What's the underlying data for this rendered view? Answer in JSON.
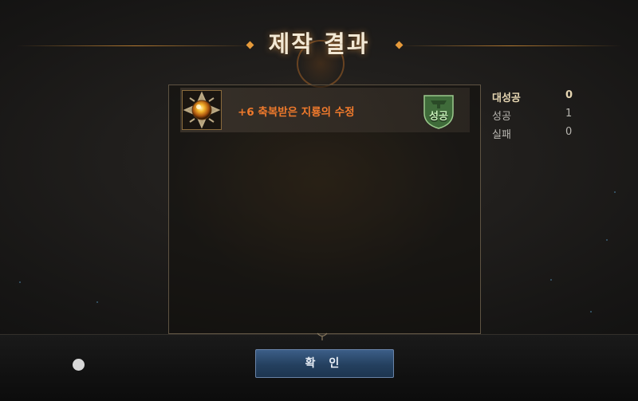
{
  "header": {
    "title": "제작 결과"
  },
  "results": [
    {
      "item_name": "+6 축복받은 지룡의 수정",
      "result": "성공"
    }
  ],
  "stats": [
    {
      "label": "대성공",
      "value": "0"
    },
    {
      "label": "성공",
      "value": "1"
    },
    {
      "label": "실패",
      "value": "0"
    }
  ],
  "footer": {
    "confirm_label": "확 인"
  },
  "colors": {
    "item_name": "#f07a2c",
    "title_glow": "#ffaa50",
    "confirm_button": "#2e4c70",
    "success_badge": "#3f6b3a"
  },
  "icons": {
    "item": "crystal-orb-icon",
    "result_badge": "anvil-shield-icon",
    "home": "floating-dot-icon"
  }
}
